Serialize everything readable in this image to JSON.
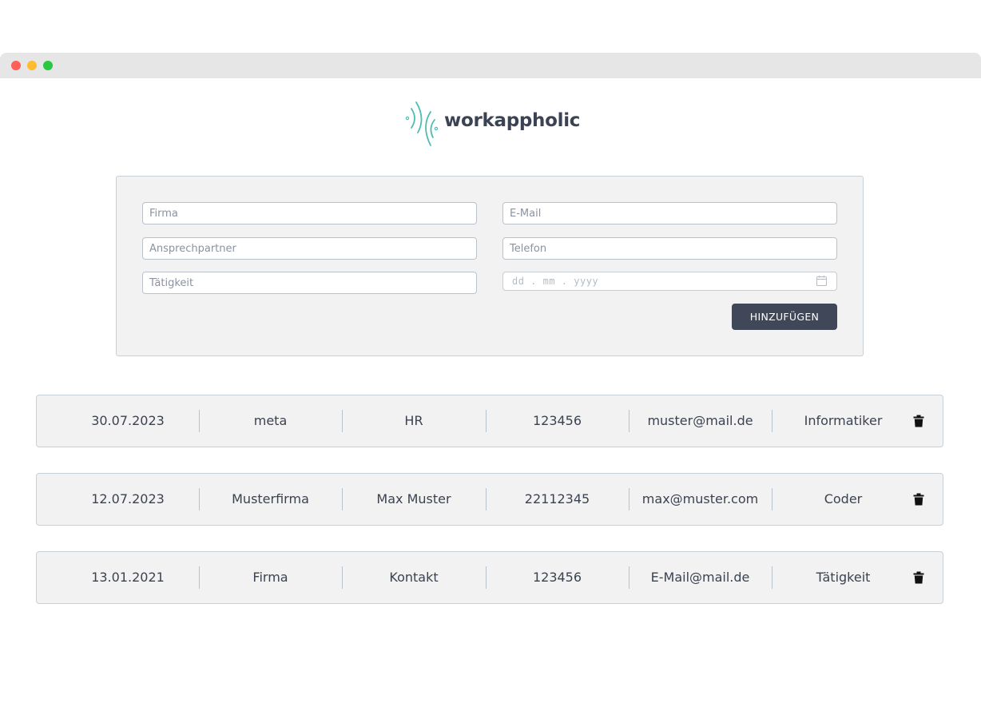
{
  "window": {
    "controls": [
      "close",
      "minimize",
      "zoom"
    ]
  },
  "logo": {
    "text": "workappholic",
    "icon": "sound-wave-logo-icon",
    "accent": "#4dbdb3"
  },
  "form": {
    "firma_placeholder": "Firma",
    "email_placeholder": "E-Mail",
    "ansprechpartner_placeholder": "Ansprechpartner",
    "telefon_placeholder": "Telefon",
    "taetigkeit_placeholder": "Tätigkeit",
    "date_placeholder": "dd . mm . yyyy",
    "date_icon": "calendar-icon",
    "add_label": "HINZUFÜGEN"
  },
  "entries": [
    {
      "date": "30.07.2023",
      "firma": "meta",
      "kontakt": "HR",
      "telefon": "123456",
      "email": "muster@mail.de",
      "taetigkeit": "Informatiker",
      "delete_icon": "trash-icon"
    },
    {
      "date": "12.07.2023",
      "firma": "Musterfirma",
      "kontakt": "Max Muster",
      "telefon": "22112345",
      "email": "max@muster.com",
      "taetigkeit": "Coder",
      "delete_icon": "trash-icon"
    },
    {
      "date": "13.01.2021",
      "firma": "Firma",
      "kontakt": "Kontakt",
      "telefon": "123456",
      "email": "E-Mail@mail.de",
      "taetigkeit": "Tätigkeit",
      "delete_icon": "trash-icon"
    }
  ],
  "colors": {
    "button": "#3f4758",
    "panel": "#f2f2f2",
    "border": "#c9d0d6",
    "text": "#3b4250"
  }
}
